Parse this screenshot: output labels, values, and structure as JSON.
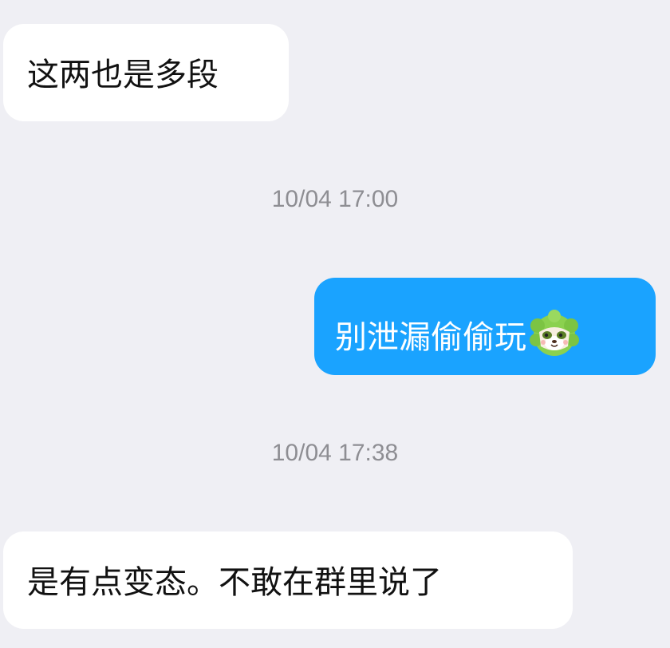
{
  "messages": [
    {
      "direction": "incoming",
      "text": "这两也是多段"
    },
    {
      "direction": "outgoing",
      "text": "别泄漏偷偷玩",
      "sticker_icon": "cabbage-dog-icon"
    },
    {
      "direction": "incoming",
      "text": "是有点变态。不敢在群里说了"
    }
  ],
  "timestamps": [
    "10/04 17:00",
    "10/04 17:38"
  ],
  "colors": {
    "background": "#efeff4",
    "incoming_bubble": "#ffffff",
    "outgoing_bubble": "#1aa3ff",
    "timestamp_text": "#8e8e93"
  }
}
